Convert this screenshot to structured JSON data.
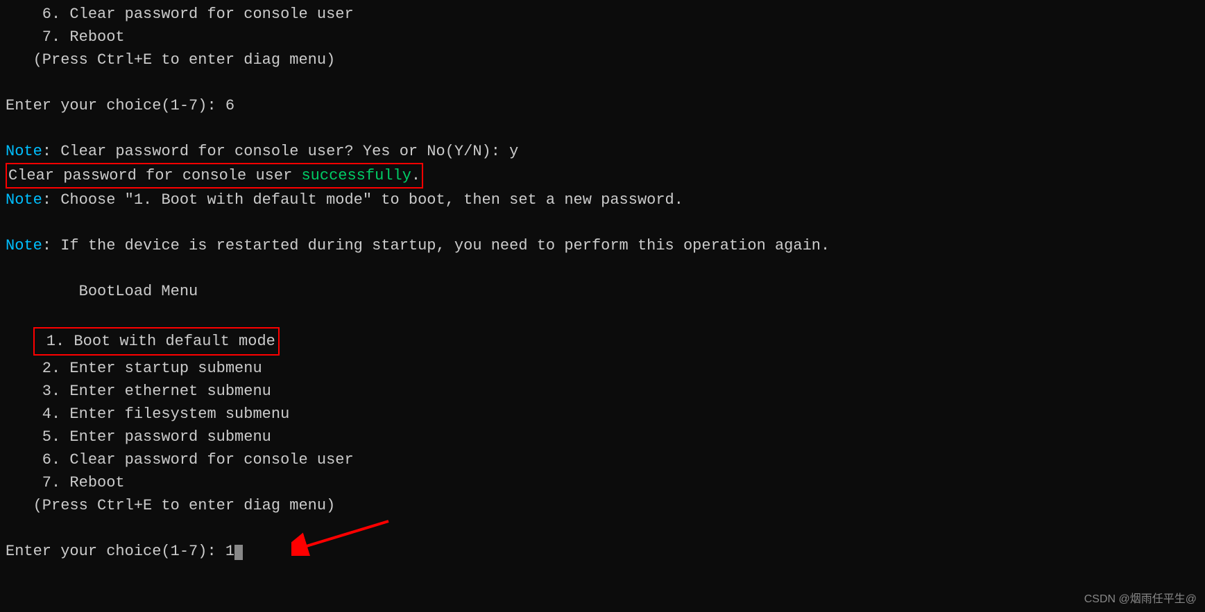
{
  "top_menu": {
    "item6": "    6. Clear password for console user",
    "item7": "    7. Reboot",
    "hint": "   (Press Ctrl+E to enter diag menu)"
  },
  "prompt1": {
    "label": "Enter your choice(1-7): ",
    "value": "6"
  },
  "notes": {
    "note_label": "Note",
    "confirm_text": ": Clear password for console user? Yes or No(Y/N): ",
    "confirm_input": "y",
    "success_prefix": "Clear password for console user ",
    "success_word": "successfully",
    "success_suffix": ".",
    "boot_hint": ": Choose \"1. Boot with default mode\" to boot, then set a new password.",
    "restart_hint": ": If the device is restarted during startup, you need to perform this operation again."
  },
  "bootload": {
    "title": "        BootLoad Menu",
    "item1": " 1. Boot with default mode",
    "item2": "    2. Enter startup submenu",
    "item3": "    3. Enter ethernet submenu",
    "item4": "    4. Enter filesystem submenu",
    "item5": "    5. Enter password submenu",
    "item6": "    6. Clear password for console user",
    "item7": "    7. Reboot",
    "hint": "   (Press Ctrl+E to enter diag menu)"
  },
  "prompt2": {
    "label": "Enter your choice(1-7): ",
    "value": "1"
  },
  "watermark": "CSDN @烟雨任平生@"
}
